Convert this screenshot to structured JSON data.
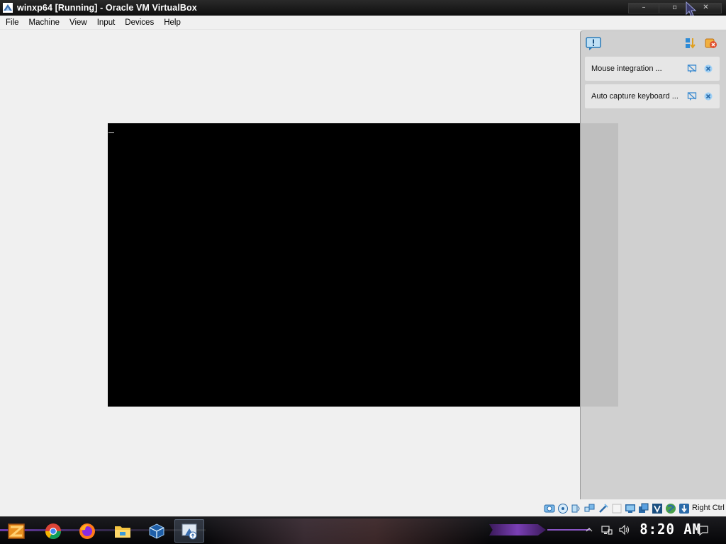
{
  "window": {
    "title": "winxp64 [Running] - Oracle VM VirtualBox",
    "controls": {
      "minimize": "–",
      "maximize": "▫",
      "close": "✕"
    }
  },
  "menu": [
    "File",
    "Machine",
    "View",
    "Input",
    "Devices",
    "Help"
  ],
  "notifications": {
    "items": [
      {
        "label": "Mouse integration ...",
        "icon_disable": "no-show-icon",
        "icon_close": "close-icon"
      },
      {
        "label": "Auto capture keyboard ...",
        "icon_disable": "no-show-icon",
        "icon_close": "close-icon"
      }
    ]
  },
  "statusbar": {
    "icons": [
      "hard-disk-icon",
      "optical-drive-icon",
      "audio-icon",
      "network-icon",
      "usb-icon",
      "shared-folders-icon",
      "display-icon",
      "recording-icon",
      "cpu-icon",
      "mouse-integration-icon",
      "keyboard-capture-icon"
    ],
    "host_key": "Right Ctrl"
  },
  "taskbar": {
    "apps": [
      "start-icon",
      "chrome-icon",
      "firefox-icon",
      "file-explorer-icon",
      "virtualbox-icon",
      "virtualbox-vm-icon"
    ],
    "clock": "8:20 AM"
  },
  "colors": {
    "titlebar": "#1a1a1a",
    "menubar": "#f0f0f0",
    "vm_screen": "#000000",
    "panel": "#cecece",
    "taskbar": "#0d0d10",
    "accent_purple": "#7a3fb5"
  }
}
